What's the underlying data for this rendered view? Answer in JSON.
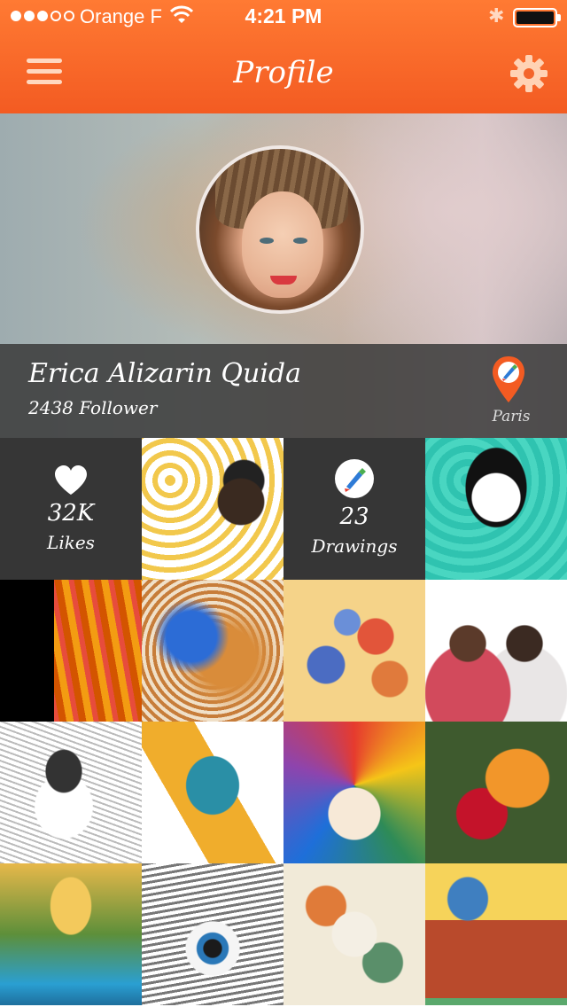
{
  "status_bar": {
    "carrier": "Orange F",
    "time": "4:21 PM",
    "signal_bars": 3,
    "signal_total": 5
  },
  "header": {
    "title": "Profile",
    "menu_icon": "hamburger-menu-icon",
    "settings_icon": "gear-icon",
    "background_color": "#f4642a"
  },
  "profile": {
    "name": "Erica Alizarin Quida",
    "followers": "2438 Follower",
    "location": "Paris"
  },
  "stats": {
    "likes": {
      "value": "32K",
      "label": "Likes",
      "icon": "heart-icon"
    },
    "drawings": {
      "value": "23",
      "label": "Drawings",
      "icon": "brush-icon"
    }
  },
  "gallery": {
    "count_visible": 14
  }
}
